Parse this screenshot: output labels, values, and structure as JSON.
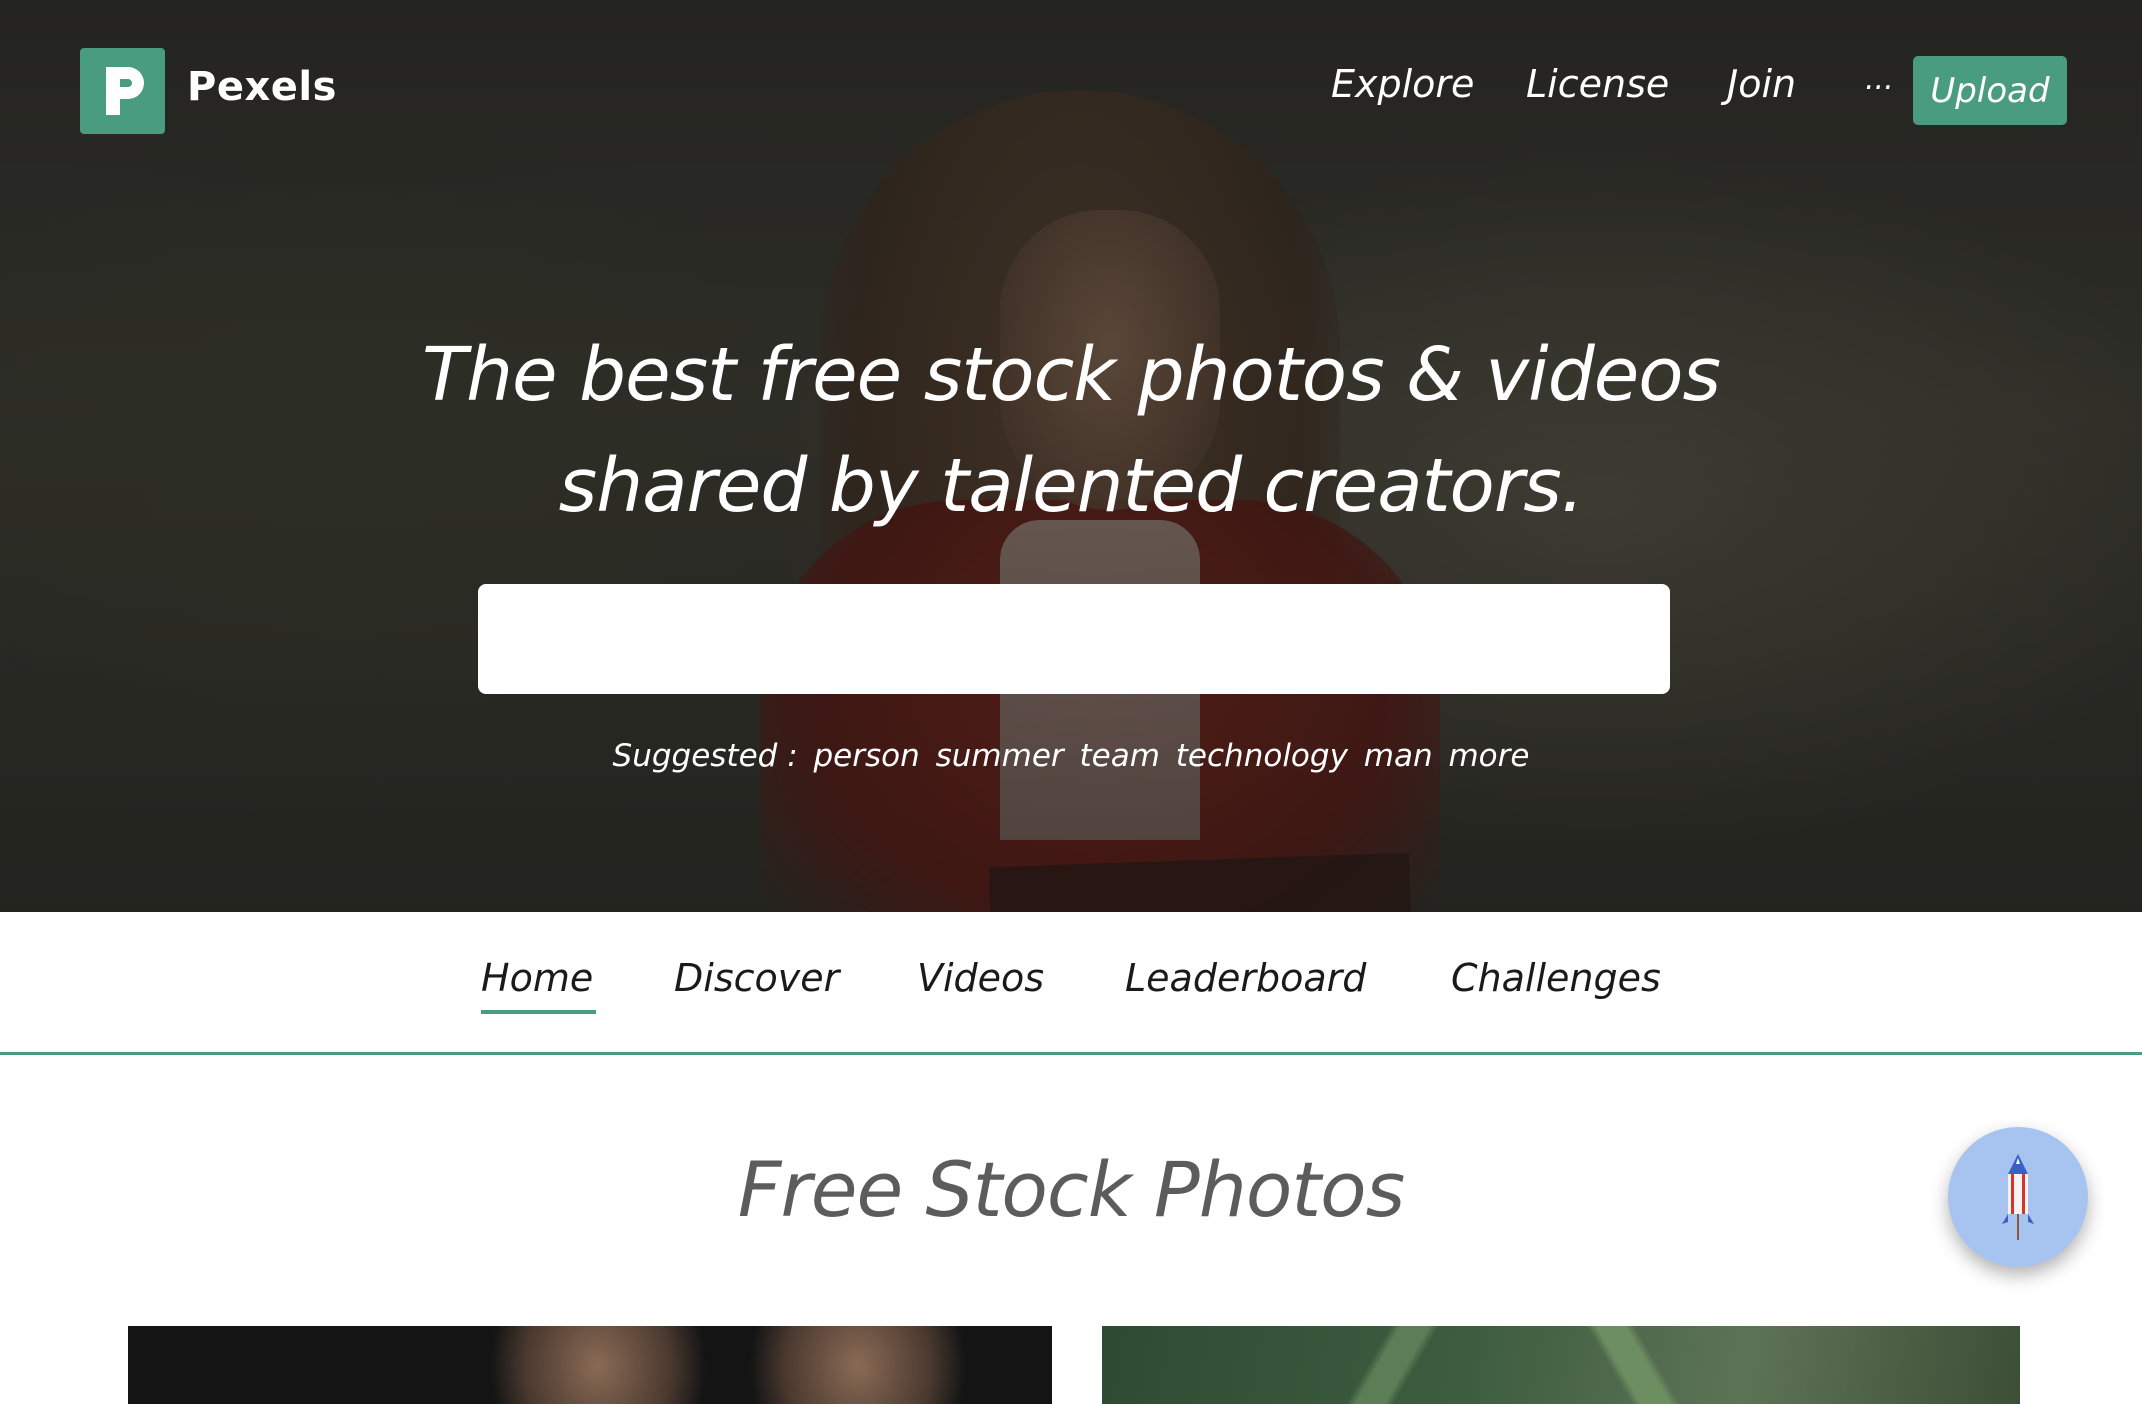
{
  "brand": {
    "name": "Pexels",
    "accent_color": "#4a9c80"
  },
  "topnav": {
    "items": [
      "Explore",
      "License",
      "Join"
    ],
    "more_label": "...",
    "upload_label": "Upload"
  },
  "hero": {
    "headline_line1": "The best free stock photos & videos",
    "headline_line2": "shared by talented creators.",
    "search": {
      "value": "",
      "placeholder": ""
    },
    "suggested_label": "Suggested :",
    "suggested_items": [
      "person",
      "summer",
      "team",
      "technology",
      "man",
      "more"
    ]
  },
  "subnav": {
    "tabs": [
      "Home",
      "Discover",
      "Videos",
      "Leaderboard",
      "Challenges"
    ],
    "active_tab": "Home"
  },
  "content": {
    "section_title": "Free Stock Photos"
  },
  "fab": {
    "icon": "rocket-icon",
    "color": "#a7c3ef"
  }
}
